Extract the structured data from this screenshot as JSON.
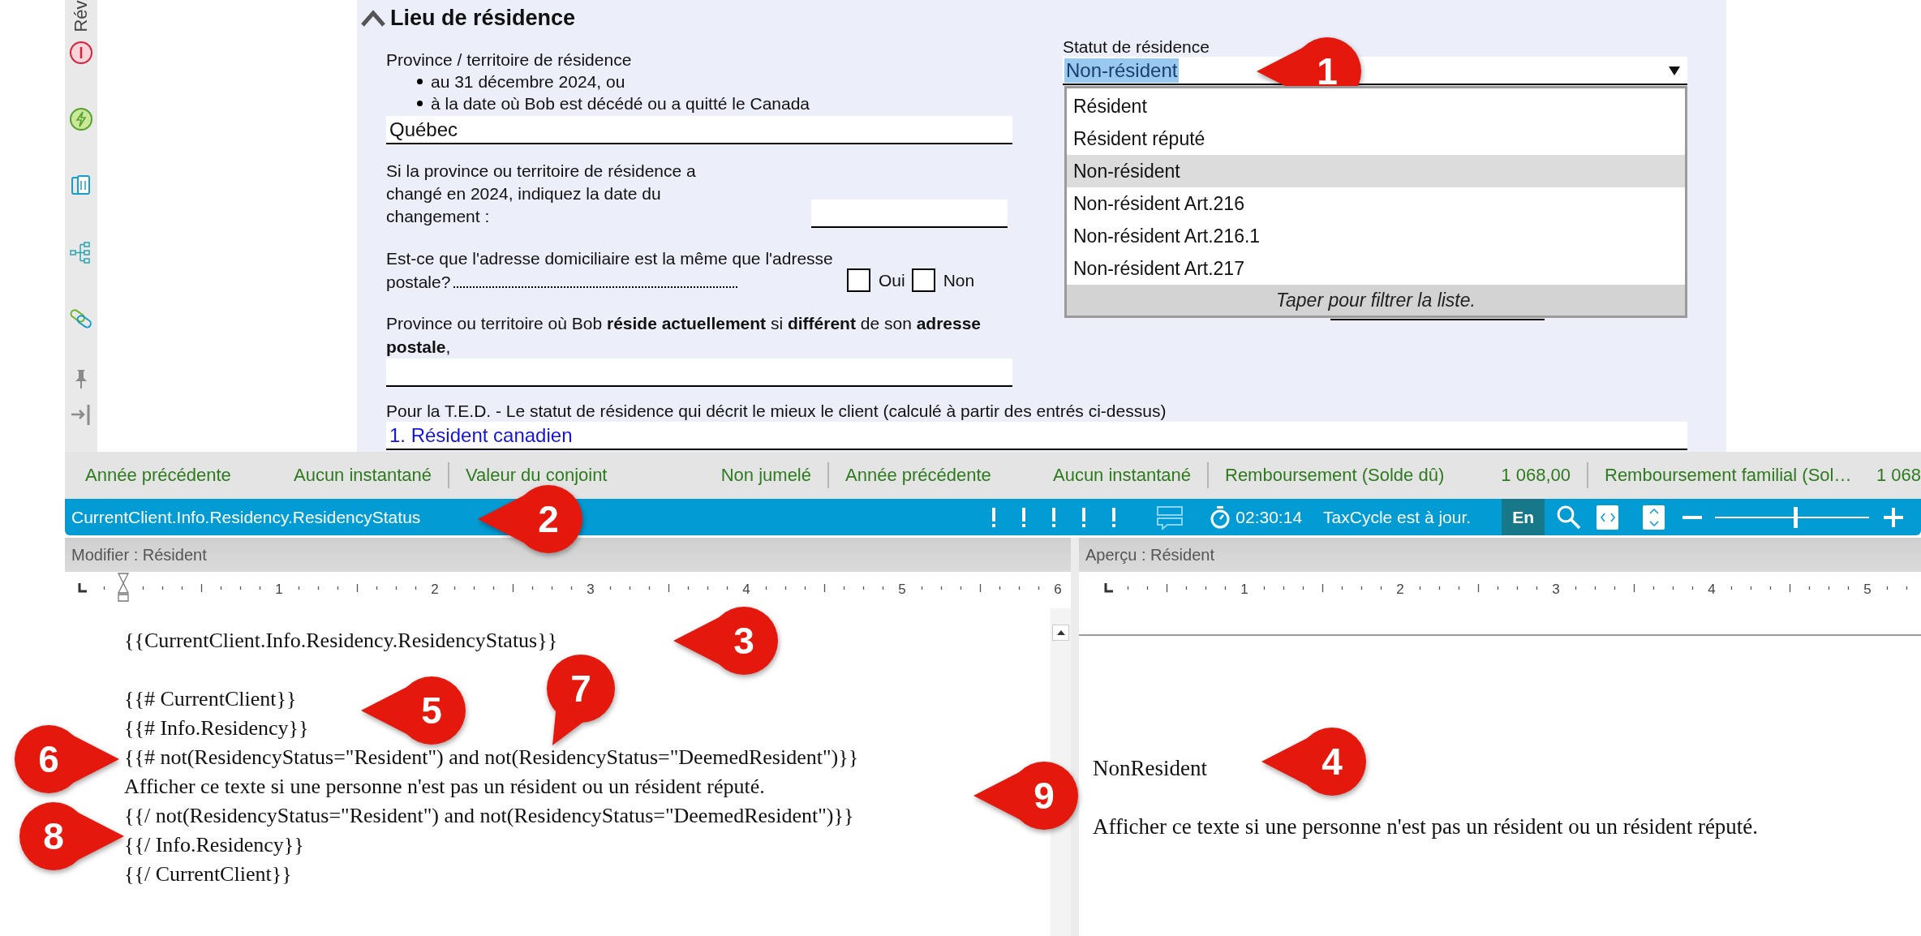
{
  "sidebar": {
    "label": "Rév"
  },
  "form": {
    "heading": "Lieu de résidence",
    "expanded": true,
    "province": {
      "label": "Province / territoire de résidence",
      "bullets": [
        "au 31 décembre 2024, ou",
        "à la date où Bob est décédé ou a quitté le Canada"
      ],
      "value": "Québec"
    },
    "change_date": {
      "label": "Si la province ou territoire de résidence a changé en 2024, indiquez la date du changement :"
    },
    "same_address": {
      "label": "Est-ce que l'adresse domiciliaire est la même que l'adresse postale?",
      "options": [
        {
          "label": "Oui",
          "checked": false
        },
        {
          "label": "Non",
          "checked": false
        }
      ]
    },
    "current_province": {
      "label": "Province ou territoire où Bob **réside actuellement** si **différent** de son **adresse postale**,"
    },
    "residency_status": {
      "label": "Statut de résidence",
      "value": "Non-résident",
      "text_selected": true,
      "expanded": true,
      "options": [
        {
          "label": "Résident",
          "selected": false
        },
        {
          "label": "Résident réputé",
          "selected": false
        },
        {
          "label": "Non-résident",
          "selected": true
        },
        {
          "label": "Non-résident Art.216",
          "selected": false
        },
        {
          "label": "Non-résident Art.216.1",
          "selected": false
        },
        {
          "label": "Non-résident Art.217",
          "selected": false
        }
      ],
      "filter_hint": "Taper pour filtrer la liste."
    },
    "ted": {
      "label": "Pour la T.E.D. - Le statut de résidence qui décrit le mieux le client (calculé à partir des entrés ci-dessus)",
      "value": "1. Résident canadien"
    }
  },
  "status_bar": [
    {
      "items": [
        "Année précédente",
        "Aucun instantané"
      ]
    },
    {
      "items": [
        "Valeur du conjoint",
        "Non jumelé"
      ]
    },
    {
      "items": [
        "Année précédente",
        "Aucun instantané"
      ]
    },
    {
      "items": [
        "Remboursement (Solde dû)",
        "1 068,00"
      ]
    },
    {
      "items": [
        "Remboursement familial (Sol…",
        "1 068"
      ]
    }
  ],
  "info_bar": {
    "field_path": "CurrentClient.Info.Residency.ResidencyStatus",
    "timer": "02:30:14",
    "sync_status": "TaxCycle est à jour.",
    "language": "En",
    "zoom": {
      "level": 0.52
    }
  },
  "editor": {
    "title": "Modifier : Résident",
    "ruler": [
      "1",
      "2",
      "3",
      "4",
      "5",
      "6"
    ],
    "blocks": [
      [
        "{{CurrentClient.Info.Residency.ResidencyStatus}}"
      ],
      [
        "{{# CurrentClient}}",
        "{{# Info.Residency}}",
        "{{# not(ResidencyStatus=\"Resident\") and not(ResidencyStatus=\"DeemedResident\")}}",
        "Afficher ce texte si une personne n'est pas un résident ou un résident réputé.",
        "{{/ not(ResidencyStatus=\"Resident\") and not(ResidencyStatus=\"DeemedResident\")}}",
        "{{/ Info.Residency}}",
        "{{/ CurrentClient}}"
      ]
    ]
  },
  "preview": {
    "title": "Aperçu : Résident",
    "ruler": [
      "1",
      "2",
      "3",
      "4",
      "5"
    ],
    "blocks": [
      [
        "NonResident"
      ],
      [
        "Afficher ce texte si une personne n'est pas un résident ou un résident réputé."
      ]
    ]
  },
  "callouts": [
    {
      "number": "1"
    },
    {
      "number": "2"
    },
    {
      "number": "3"
    },
    {
      "number": "4"
    },
    {
      "number": "5"
    },
    {
      "number": "6"
    },
    {
      "number": "7"
    },
    {
      "number": "8"
    },
    {
      "number": "9"
    }
  ]
}
